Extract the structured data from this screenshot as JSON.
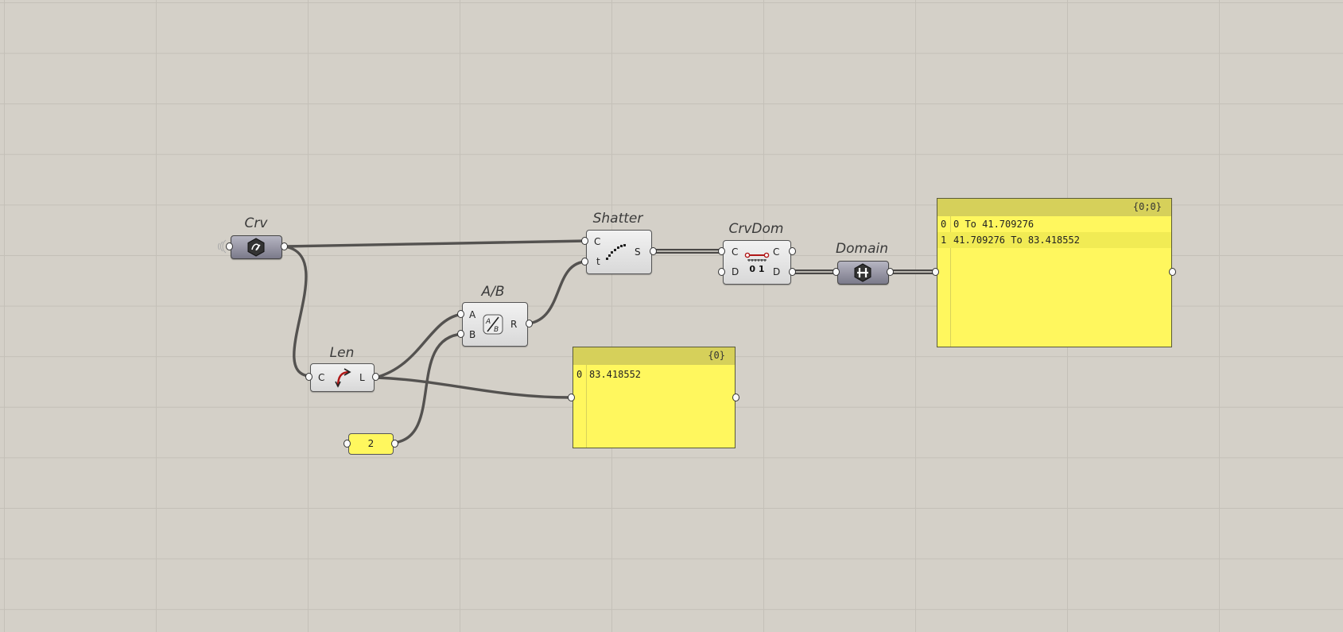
{
  "canvas": {
    "background": "#d4d0c8",
    "grid_color": "#c4c0b8"
  },
  "components": {
    "crv": {
      "nickname": "Crv",
      "icon": "curve-param-icon"
    },
    "len": {
      "nickname": "Len",
      "input": "C",
      "output": "L",
      "icon": "length-icon"
    },
    "divide": {
      "nickname": "A/B",
      "inputs": [
        "A",
        "B"
      ],
      "output": "R",
      "icon": "division-icon"
    },
    "shatter": {
      "nickname": "Shatter",
      "inputs": [
        "C",
        "t"
      ],
      "output": "S",
      "icon": "shatter-icon"
    },
    "crvdom": {
      "nickname": "CrvDom",
      "inputs": [
        "C",
        "D"
      ],
      "outputs": [
        "C",
        "D"
      ],
      "icon": "curve-domain-icon",
      "icon_text": "0 1"
    },
    "domain": {
      "nickname": "Domain",
      "icon": "domain-param-icon"
    },
    "number": {
      "value": "2"
    }
  },
  "panels": {
    "length_panel": {
      "path": "{0}",
      "rows": [
        {
          "index": "0",
          "value": "83.418552"
        }
      ]
    },
    "domain_panel": {
      "path": "{0;0}",
      "rows": [
        {
          "index": "0",
          "value": "0 To 41.709276"
        },
        {
          "index": "1",
          "value": "41.709276 To 83.418552"
        }
      ]
    }
  },
  "colors": {
    "panel_fill": "#fff75e",
    "panel_header": "#d6d05a",
    "wire": "#545250",
    "icon_accent": "#b01818"
  }
}
